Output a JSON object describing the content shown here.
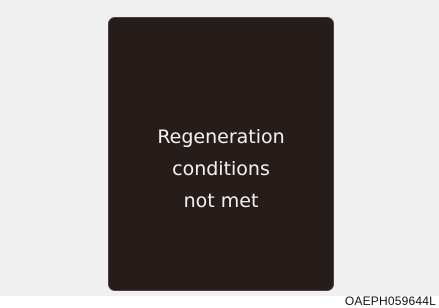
{
  "display": {
    "message_lines": [
      "Regeneration",
      "conditions",
      "not met"
    ]
  },
  "figure_code": "OAEPH059644L",
  "colors": {
    "panel_background": "#261d1b",
    "message_text": "#f2f2f2",
    "page_background": "#f0f0f0"
  }
}
